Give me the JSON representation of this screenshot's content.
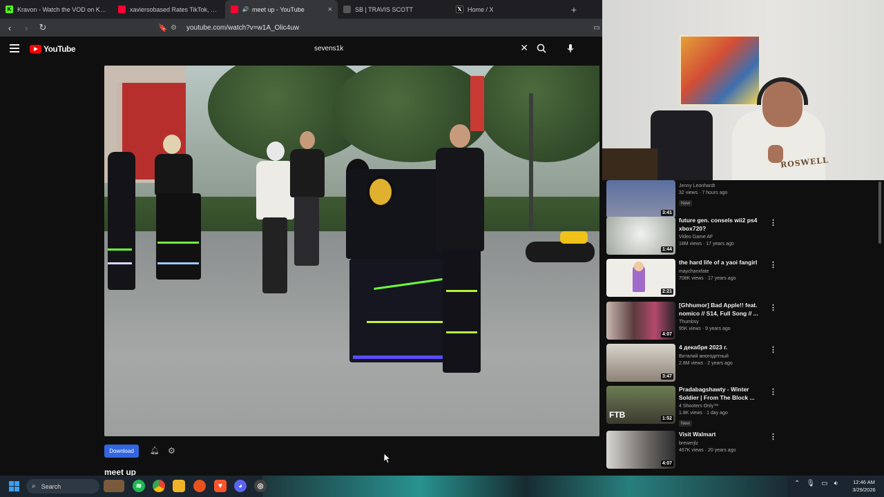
{
  "browser": {
    "tabs": [
      {
        "title": "Kravon - Watch the VOD on Kick",
        "icon": "kick-icon",
        "active": false
      },
      {
        "title": "xaviersobased Rates TikTok, Bushwick",
        "icon": "youtube-icon",
        "active": false
      },
      {
        "title": "meet up - YouTube",
        "icon": "youtube-icon",
        "active": true
      },
      {
        "title": "SB | TRAVIS SCOTT",
        "icon": "page-icon",
        "active": false
      },
      {
        "title": "Home / X",
        "icon": "x-icon",
        "active": false
      }
    ],
    "new_tab": "+",
    "close_glyph": "×",
    "url": "youtube.com/watch?v=w1A_Olic4uw"
  },
  "youtube": {
    "logo_text": "YouTube",
    "search_value": "sevens1k",
    "clear_glyph": "✕"
  },
  "player": {
    "download_label": "Download",
    "title": "meet up"
  },
  "recommendations": [
    {
      "title": "",
      "channel": "Jenny Leonhardt",
      "stats": "32 views · 7 hours ago",
      "badge": "New",
      "duration": "3:41",
      "thumb": "#8a8fa8"
    },
    {
      "title": "future gen. consels wii2 ps4 xbox720?",
      "channel": "Video Game AF",
      "stats": "18M views · 17 years ago",
      "badge": "",
      "duration": "1:44",
      "thumb": "#b7c0b6"
    },
    {
      "title": "the hard life of a yaoi fangirl",
      "channel": "maychanxfate",
      "stats": "708K views · 17 years ago",
      "badge": "",
      "duration": "2:21",
      "thumb": "#e8e6e0"
    },
    {
      "title": "[Ghhumor] Bad Apple!! feat. nomico // S14, Full Song // ...",
      "channel": "Thumbsy",
      "stats": "95K views · 9 years ago",
      "badge": "",
      "duration": "4:07",
      "thumb": "#7a5b58"
    },
    {
      "title": "4 декабря 2023 г.",
      "channel": "Виталий многодетный",
      "stats": "2.8M views · 2 years ago",
      "badge": "",
      "duration": "3:47",
      "thumb": "#9b8f82"
    },
    {
      "title": "Pradabagshawty - Winter Soldier | From The Block ...",
      "channel": "4 Shooters Only™",
      "stats": "1.8K views · 1 day ago",
      "badge": "New",
      "duration": "1:52",
      "thumb": "#5d5a4e"
    },
    {
      "title": "Visit Walmart",
      "channel": "brewerjlz",
      "stats": "467K views · 20 years ago",
      "badge": "",
      "duration": "4:07",
      "thumb": "#8d8a86"
    }
  ],
  "webcam": {
    "shirt_text": "ROSWELL"
  },
  "taskbar": {
    "search_label": "Search",
    "time": "12:46 AM",
    "date": "3/29/2026"
  }
}
